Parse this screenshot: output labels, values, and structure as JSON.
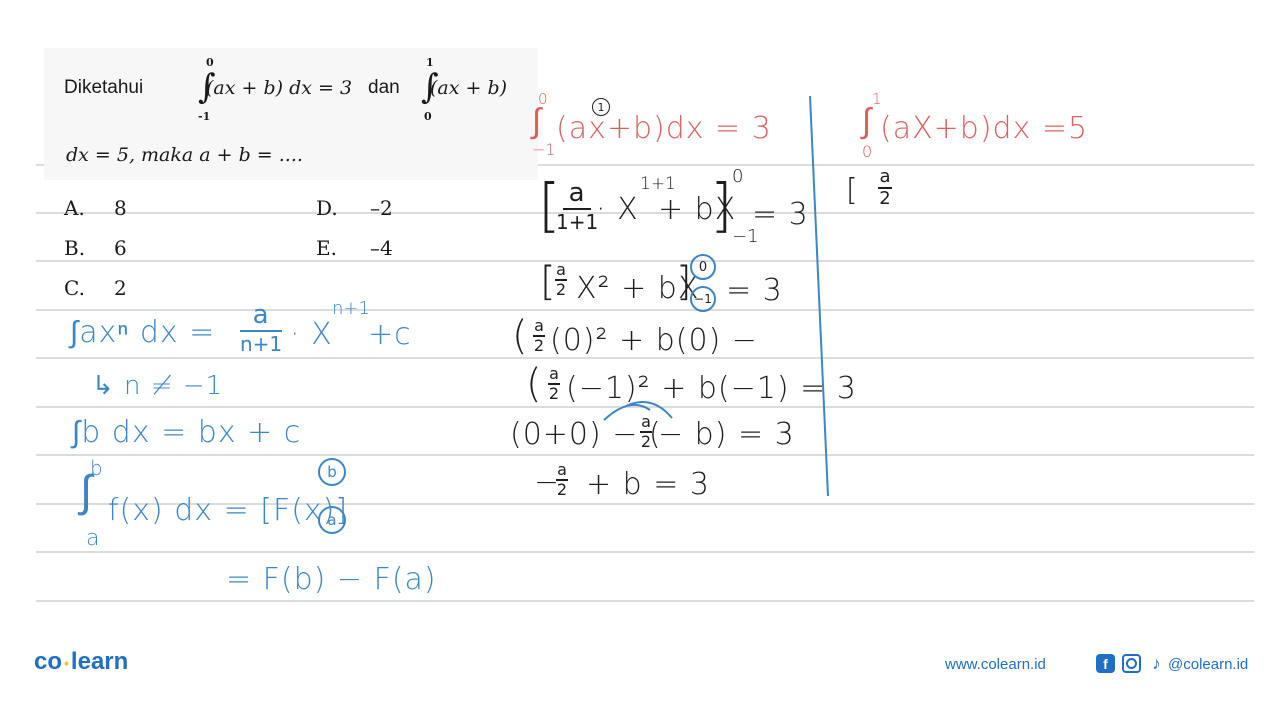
{
  "question": {
    "intro": "Diketahui",
    "integral1": {
      "upper": "0",
      "lower": "-1",
      "integrand": "(ax + b) dx = 3"
    },
    "connector": "dan",
    "integral2": {
      "upper": "1",
      "lower": "0",
      "integrand": "(ax + b)"
    },
    "line2": "dx = 5,  maka a + b = ....",
    "options": [
      {
        "letter": "A.",
        "value": "8"
      },
      {
        "letter": "B.",
        "value": "6"
      },
      {
        "letter": "C.",
        "value": "2"
      },
      {
        "letter": "D.",
        "value": "–2"
      },
      {
        "letter": "E.",
        "value": "–4"
      }
    ]
  },
  "notes_left": {
    "power_rule": {
      "lhs": "∫axⁿ dx =",
      "frac_num": "a",
      "frac_den": "n+1",
      "rest": "· X",
      "exp": "n+1",
      "tail": "+c"
    },
    "condition": "↳ n ≠ −1",
    "constant_rule": "∫b dx = bx + c",
    "definite": {
      "upper": "b",
      "lower": "a",
      "lhs": "f(x) dx = [F(x)]",
      "circ_upper": "b",
      "circ_lower": "a"
    },
    "result": "= F(b) − F(a)"
  },
  "notes_middle": {
    "given": {
      "upper": "0",
      "lower": "−1",
      "expr": "(ax+b)dx = 3",
      "marker": "1"
    },
    "step1": {
      "frac_num": "a",
      "frac_den": "1+1",
      "mid": "· X",
      "exp": "1+1",
      "tail": "+ bX",
      "upper": "0",
      "lower": "−1",
      "eq": "= 3"
    },
    "step2": {
      "frac_num": "a",
      "frac_den": "2",
      "mid": "X² + bX",
      "circ_upper": "0",
      "circ_lower": "−1",
      "eq": "= 3"
    },
    "step3": {
      "open": "(",
      "frac_num": "a",
      "frac_den": "2",
      "rest": "(0)² + b(0) −"
    },
    "step4": {
      "open": "(",
      "frac_num": "a",
      "frac_den": "2",
      "rest": "(−1)² + b(−1)  = 3"
    },
    "step5": {
      "pre": "(0+0) − (",
      "frac_num": "a",
      "frac_den": "2",
      "post": "− b)  = 3"
    },
    "step6": {
      "pre": "−",
      "frac_num": "a",
      "frac_den": "2",
      "post": "+ b  = 3"
    }
  },
  "notes_right": {
    "given": {
      "upper": "1",
      "lower": "0",
      "expr": "(aX+b)dx =5"
    },
    "step1": {
      "open": "[",
      "frac_num": "a",
      "frac_den": "2"
    }
  },
  "footer": {
    "logo_left": "co",
    "logo_dot": "•",
    "logo_right": "learn",
    "url": "www.colearn.id",
    "social_icons": [
      "facebook-icon",
      "instagram-icon",
      "tiktok-icon"
    ],
    "fb_glyph": "f",
    "tt_glyph": "♪",
    "handle": "@colearn.id"
  },
  "colors": {
    "blue_ink": "#3b86c6",
    "red_ink": "#d8625f",
    "black_ink": "#1e1e1e",
    "brand": "#1f6fc4"
  }
}
